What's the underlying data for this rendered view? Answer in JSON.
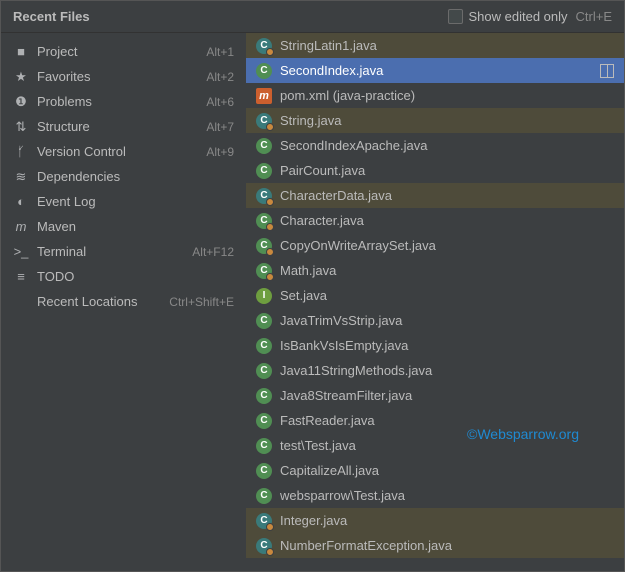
{
  "header": {
    "title": "Recent Files",
    "show_edited_only": "Show edited only",
    "shortcut": "Ctrl+E"
  },
  "sidebar": {
    "items": [
      {
        "icon": "folder-icon",
        "glyph": "■",
        "label": "Project",
        "shortcut": "Alt+1"
      },
      {
        "icon": "star-icon",
        "glyph": "★",
        "label": "Favorites",
        "shortcut": "Alt+2"
      },
      {
        "icon": "alert-icon",
        "glyph": "❶",
        "label": "Problems",
        "shortcut": "Alt+6"
      },
      {
        "icon": "structure-icon",
        "glyph": "⇅",
        "label": "Structure",
        "shortcut": "Alt+7"
      },
      {
        "icon": "branch-icon",
        "glyph": "ᚶ",
        "label": "Version Control",
        "shortcut": "Alt+9"
      },
      {
        "icon": "layers-icon",
        "glyph": "≋",
        "label": "Dependencies",
        "shortcut": ""
      },
      {
        "icon": "chat-icon",
        "glyph": "◐",
        "label": "Event Log",
        "shortcut": ""
      },
      {
        "icon": "maven-m-icon",
        "glyph": "m",
        "label": "Maven",
        "shortcut": ""
      },
      {
        "icon": "terminal-icon",
        "glyph": ">_",
        "label": "Terminal",
        "shortcut": "Alt+F12"
      },
      {
        "icon": "todo-icon",
        "glyph": "≡",
        "label": "TODO",
        "shortcut": ""
      },
      {
        "icon": "locations-icon",
        "glyph": "",
        "label": "Recent Locations",
        "shortcut": "Ctrl+Shift+E"
      }
    ]
  },
  "files": [
    {
      "name": "StringLatin1.java",
      "icon": "class",
      "highlight": true,
      "selected": false,
      "pinned": true
    },
    {
      "name": "SecondIndex.java",
      "icon": "class",
      "highlight": false,
      "selected": true,
      "pinned": false,
      "split": true
    },
    {
      "name": "pom.xml (java-practice)",
      "icon": "maven",
      "highlight": false,
      "selected": false,
      "pinned": false
    },
    {
      "name": "String.java",
      "icon": "class",
      "highlight": true,
      "selected": false,
      "pinned": true
    },
    {
      "name": "SecondIndexApache.java",
      "icon": "class",
      "highlight": false,
      "selected": false,
      "pinned": false
    },
    {
      "name": "PairCount.java",
      "icon": "class",
      "highlight": false,
      "selected": false,
      "pinned": false
    },
    {
      "name": "CharacterData.java",
      "icon": "class",
      "highlight": true,
      "selected": false,
      "pinned": true
    },
    {
      "name": "Character.java",
      "icon": "class",
      "highlight": false,
      "selected": false,
      "pinned": true
    },
    {
      "name": "CopyOnWriteArraySet.java",
      "icon": "class",
      "highlight": false,
      "selected": false,
      "pinned": true
    },
    {
      "name": "Math.java",
      "icon": "class",
      "highlight": false,
      "selected": false,
      "pinned": true
    },
    {
      "name": "Set.java",
      "icon": "interface",
      "highlight": false,
      "selected": false,
      "pinned": true
    },
    {
      "name": "JavaTrimVsStrip.java",
      "icon": "class",
      "highlight": false,
      "selected": false,
      "pinned": false
    },
    {
      "name": "IsBankVsIsEmpty.java",
      "icon": "class",
      "highlight": false,
      "selected": false,
      "pinned": false
    },
    {
      "name": "Java11StringMethods.java",
      "icon": "class",
      "highlight": false,
      "selected": false,
      "pinned": false
    },
    {
      "name": "Java8StreamFilter.java",
      "icon": "class",
      "highlight": false,
      "selected": false,
      "pinned": false
    },
    {
      "name": "FastReader.java",
      "icon": "class",
      "highlight": false,
      "selected": false,
      "pinned": false
    },
    {
      "name": "test\\Test.java",
      "icon": "class",
      "highlight": false,
      "selected": false,
      "pinned": false
    },
    {
      "name": "CapitalizeAll.java",
      "icon": "class",
      "highlight": false,
      "selected": false,
      "pinned": false
    },
    {
      "name": "websparrow\\Test.java",
      "icon": "class",
      "highlight": false,
      "selected": false,
      "pinned": false
    },
    {
      "name": "Integer.java",
      "icon": "class",
      "highlight": true,
      "selected": false,
      "pinned": true
    },
    {
      "name": "NumberFormatException.java",
      "icon": "class",
      "highlight": true,
      "selected": false,
      "pinned": true
    }
  ],
  "watermark": "©Websparrow.org"
}
